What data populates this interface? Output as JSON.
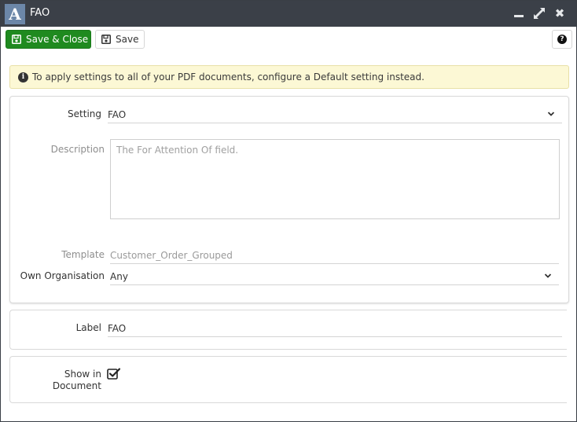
{
  "window": {
    "logo_letter": "A",
    "title": "FAO"
  },
  "toolbar": {
    "save_close_label": "Save & Close",
    "save_label": "Save"
  },
  "alert": {
    "text": "To apply settings to all of your PDF documents, configure a Default setting instead."
  },
  "form": {
    "setting": {
      "label": "Setting",
      "value": "FAO"
    },
    "description": {
      "label": "Description",
      "value": "The For Attention Of field."
    },
    "template": {
      "label": "Template",
      "value": "Customer_Order_Grouped"
    },
    "own_organisation": {
      "label": "Own Organisation",
      "value": "Any"
    },
    "label_field": {
      "label": "Label",
      "value": "FAO"
    },
    "show_in_document": {
      "label_line1": "Show in",
      "label_line2": "Document",
      "checked": true
    }
  },
  "colors": {
    "titlebar": "#3b4048",
    "primary_button": "#1f8a1f",
    "alert_background": "#fcf8d5",
    "logo_background": "#6c87a8"
  }
}
